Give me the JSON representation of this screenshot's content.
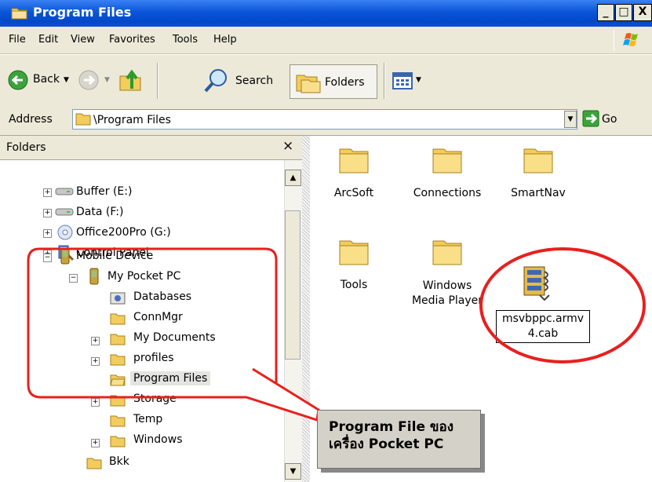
{
  "window": {
    "title": "Program Files"
  },
  "caption_buttons": {
    "minimize": "_",
    "maximize": "□",
    "close": "X"
  },
  "menu": [
    "File",
    "Edit",
    "View",
    "Favorites",
    "Tools",
    "Help"
  ],
  "toolbar": {
    "back": "Back",
    "search": "Search",
    "folders": "Folders"
  },
  "address": {
    "label": "Address",
    "value": "\\Program Files",
    "go": "Go"
  },
  "folders_pane": {
    "title": "Folders",
    "close": "×",
    "tree": [
      {
        "label": "Buffer (E:)",
        "expander": "+",
        "icon": "drive-icon"
      },
      {
        "label": "Data (F:)",
        "expander": "+",
        "icon": "drive-icon"
      },
      {
        "label": "Office200Pro (G:)",
        "expander": "+",
        "icon": "cd-drive-icon"
      },
      {
        "label": "Control Panel",
        "expander": "+",
        "icon": "control-panel-icon"
      },
      {
        "label": "Mobile Device",
        "expander": "−",
        "icon": "mobile-device-icon"
      },
      {
        "label": "My Pocket PC",
        "expander": "−",
        "icon": "pocket-pc-icon"
      },
      {
        "label": "Databases",
        "expander": "",
        "icon": "database-icon"
      },
      {
        "label": "ConnMgr",
        "expander": "",
        "icon": "folder-icon"
      },
      {
        "label": "My Documents",
        "expander": "+",
        "icon": "folder-icon"
      },
      {
        "label": "profiles",
        "expander": "+",
        "icon": "folder-icon"
      },
      {
        "label": "Program Files",
        "expander": "",
        "icon": "open-folder-icon"
      },
      {
        "label": "Storage",
        "expander": "+",
        "icon": "folder-icon"
      },
      {
        "label": "Temp",
        "expander": "",
        "icon": "folder-icon"
      },
      {
        "label": "Windows",
        "expander": "+",
        "icon": "folder-icon"
      },
      {
        "label": "Bkk",
        "expander": "",
        "icon": "folder-icon"
      }
    ]
  },
  "content": {
    "items": [
      {
        "label": "ArcSoft"
      },
      {
        "label": "Connections"
      },
      {
        "label": "SmartNav"
      },
      {
        "label": "Tools"
      },
      {
        "label_line1": "Windows",
        "label_line2": "Media Player"
      },
      {
        "label_line1": "msvbppc.armv",
        "label_line2": "4.cab"
      }
    ]
  },
  "annotation": {
    "line1": "Program File ของ",
    "line2": "เครื่อง Pocket PC"
  },
  "colors": {
    "highlight": "#e8201e",
    "titlebar": "#0a55d8",
    "chrome": "#ece9d8"
  }
}
